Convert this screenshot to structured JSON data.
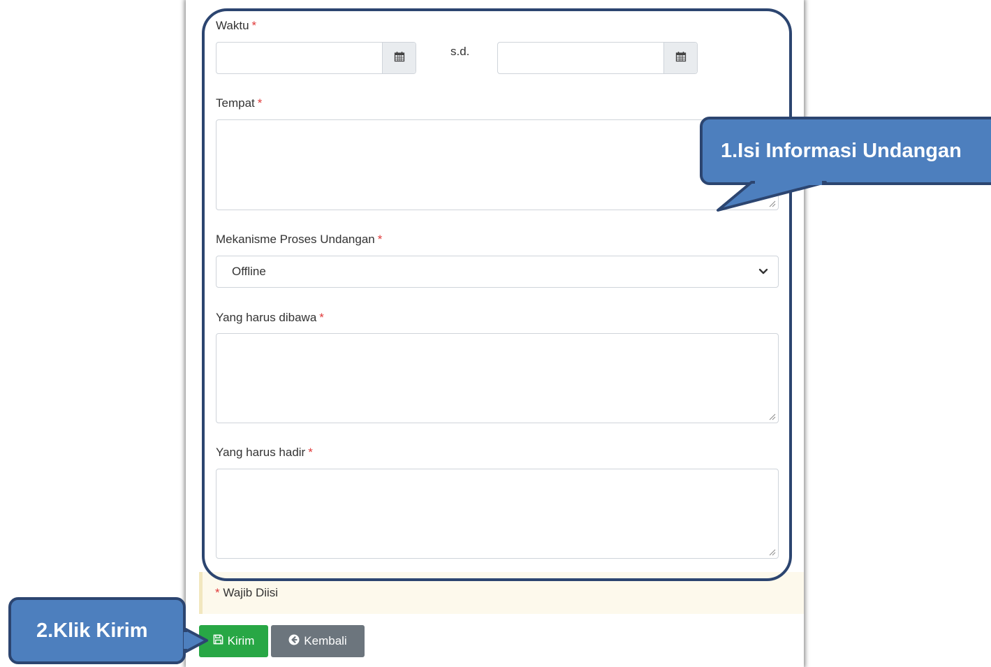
{
  "form": {
    "waktu_label": "Waktu",
    "sd_label": "s.d.",
    "tempat_label": "Tempat",
    "mekanisme_label": "Mekanisme Proses Undangan",
    "mekanisme_value": "Offline",
    "dibawa_label": "Yang harus dibawa",
    "hadir_label": "Yang harus hadir",
    "required_mark": "*"
  },
  "notice": {
    "mark": "*",
    "text": "Wajib Diisi"
  },
  "buttons": {
    "kirim": "Kirim",
    "kembali": "Kembali"
  },
  "callouts": {
    "step1": "1.Isi Informasi Undangan",
    "step2": "2.Klik Kirim"
  },
  "colors": {
    "required": "#e03a3a",
    "kirim_bg": "#28a745",
    "kembali_bg": "#6c757d",
    "callout_fill": "#4d7fbe",
    "callout_border": "#2c4570"
  },
  "icons": [
    "calendar-icon",
    "chevron-down-icon",
    "save-icon",
    "arrow-circle-left-icon"
  ]
}
